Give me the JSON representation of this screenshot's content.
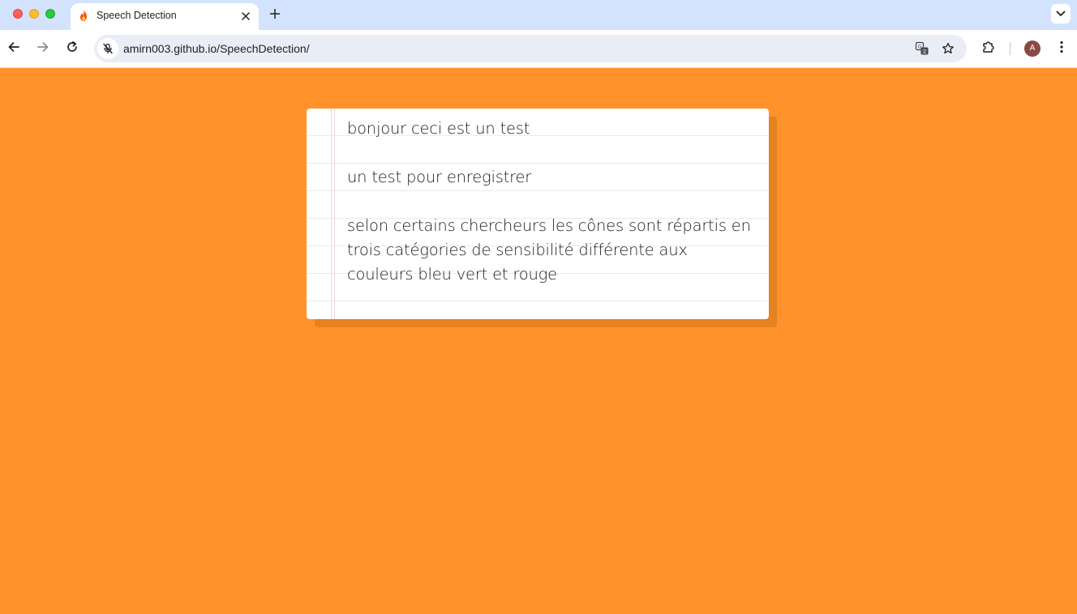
{
  "browser": {
    "tab": {
      "title": "Speech Detection",
      "favicon": "fire-icon"
    },
    "address_bar": {
      "url": "amirn003.github.io/SpeechDetection/",
      "site_icon": "mic-off-icon"
    },
    "profile_initial": "A"
  },
  "page": {
    "background_color": "#ff922b",
    "transcript": [
      "bonjour ceci est un test",
      "un test pour enregistrer",
      "selon certains chercheurs les cônes sont répartis en trois catégories de sensibilité différente aux couleurs bleu vert et rouge"
    ]
  }
}
